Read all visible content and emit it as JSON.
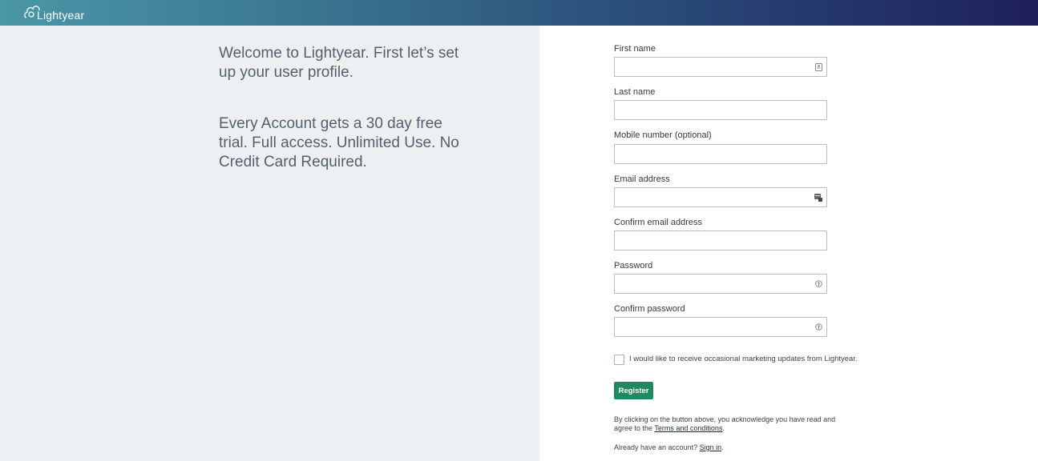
{
  "header": {
    "brand": "Lightyear"
  },
  "intro": {
    "welcome": "Welcome to Lightyear. First let’s set up your user profile.",
    "trial": "Every Account gets a 30 day free trial. Full access. Unlimited Use. No Credit Card Required."
  },
  "form": {
    "first_name": {
      "label": "First name",
      "value": "",
      "icon": "contact-card-icon"
    },
    "last_name": {
      "label": "Last name",
      "value": ""
    },
    "mobile": {
      "label": "Mobile number (optional)",
      "value": ""
    },
    "email": {
      "label": "Email address",
      "value": "",
      "icon": "autofill-card-icon"
    },
    "confirm_email": {
      "label": "Confirm email address",
      "value": ""
    },
    "password": {
      "label": "Password",
      "value": "",
      "icon": "key-icon"
    },
    "confirm_password": {
      "label": "Confirm password",
      "value": "",
      "icon": "key-icon"
    },
    "marketing_checkbox": {
      "label": "I would like to receive occasional marketing updates from Lightyear.",
      "checked": false
    },
    "register_label": "Register",
    "terms_prefix": "By clicking on the button above, you acknowledge you have read and agree to the ",
    "terms_link": "Terms and conditions",
    "terms_suffix": ".",
    "signin_prefix": "Already have an account? ",
    "signin_link": "Sign in",
    "signin_suffix": "."
  },
  "colors": {
    "accent": "#1e8b5e",
    "header_start": "#4a97a7",
    "header_end": "#1e1f5c",
    "left_panel_bg": "#edf0f3"
  }
}
